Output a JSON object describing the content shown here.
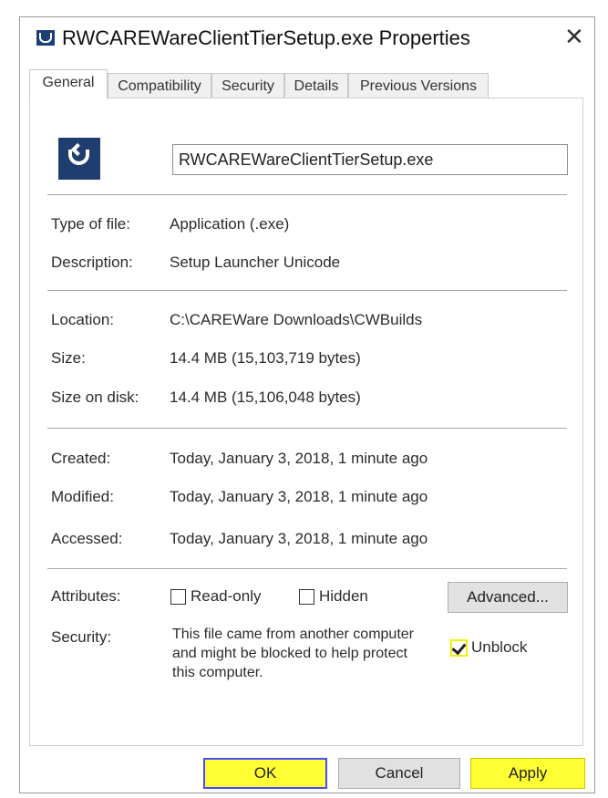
{
  "window": {
    "title": "RWCAREWareClientTierSetup.exe Properties",
    "close_glyph": "✕"
  },
  "tabs": [
    {
      "label": "General",
      "active": true
    },
    {
      "label": "Compatibility",
      "active": false
    },
    {
      "label": "Security",
      "active": false
    },
    {
      "label": "Details",
      "active": false
    },
    {
      "label": "Previous Versions",
      "active": false
    }
  ],
  "general": {
    "file_name": "RWCAREWareClientTierSetup.exe",
    "type_label": "Type of file:",
    "type_value": "Application (.exe)",
    "description_label": "Description:",
    "description_value": "Setup Launcher Unicode",
    "location_label": "Location:",
    "location_value": "C:\\CAREWare Downloads\\CWBuilds",
    "size_label": "Size:",
    "size_value": "14.4 MB (15,103,719 bytes)",
    "size_on_disk_label": "Size on disk:",
    "size_on_disk_value": "14.4 MB (15,106,048 bytes)",
    "created_label": "Created:",
    "created_value": "Today, January 3, 2018, 1 minute ago",
    "modified_label": "Modified:",
    "modified_value": "Today, January 3, 2018, 1 minute ago",
    "accessed_label": "Accessed:",
    "accessed_value": "Today, January 3, 2018, 1 minute ago",
    "attributes_label": "Attributes:",
    "readonly_label": "Read-only",
    "hidden_label": "Hidden",
    "advanced_label": "Advanced...",
    "security_label": "Security:",
    "security_line1": "This file came from another computer",
    "security_line2": "and might be blocked to help protect",
    "security_line3": "this computer.",
    "unblock_label": "Unblock",
    "readonly_checked": false,
    "hidden_checked": false,
    "unblock_checked": true
  },
  "buttons": {
    "ok": "OK",
    "cancel": "Cancel",
    "apply": "Apply"
  },
  "colors": {
    "highlight": "#ffff33",
    "icon_blue": "#203d6f"
  }
}
